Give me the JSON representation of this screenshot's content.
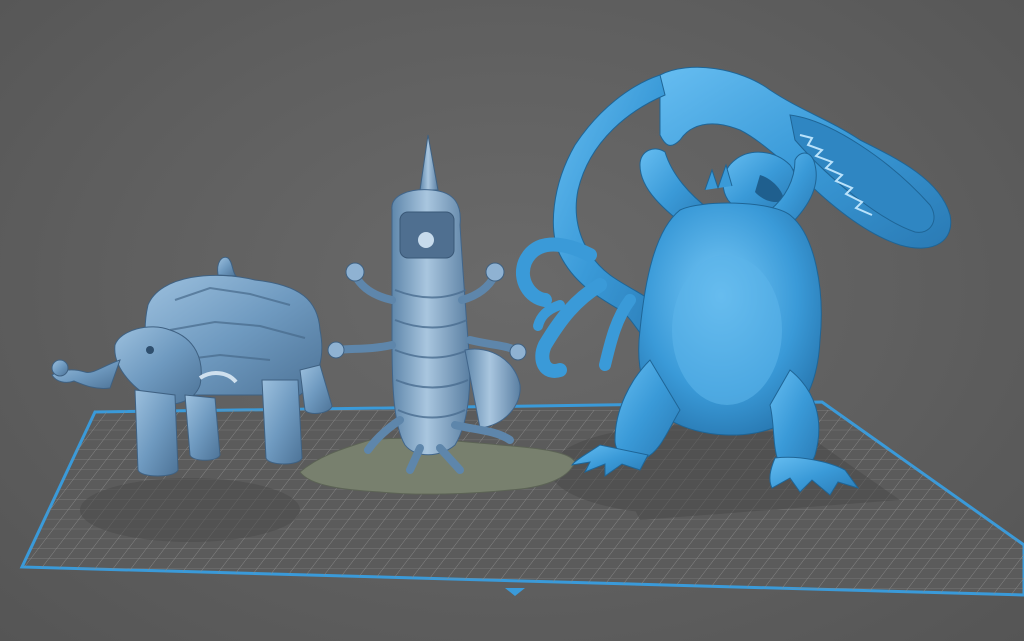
{
  "scene": {
    "background_color": "#5f5f5f",
    "bed_border_color": "#3a9ad9",
    "bed_grid_color": "#8a8a8a",
    "bed_fill_color": "#5a5a5a",
    "models": [
      {
        "name": "elephant-tortoise-monster",
        "color": "#6f9fc8",
        "selected": false
      },
      {
        "name": "centipede-worm-monster",
        "color": "#7ba3c6",
        "selected": false
      },
      {
        "name": "kaiju-lifting-serpent",
        "color": "#3f9fd6",
        "selected": true
      }
    ],
    "model_base_color": "#7a8270"
  }
}
